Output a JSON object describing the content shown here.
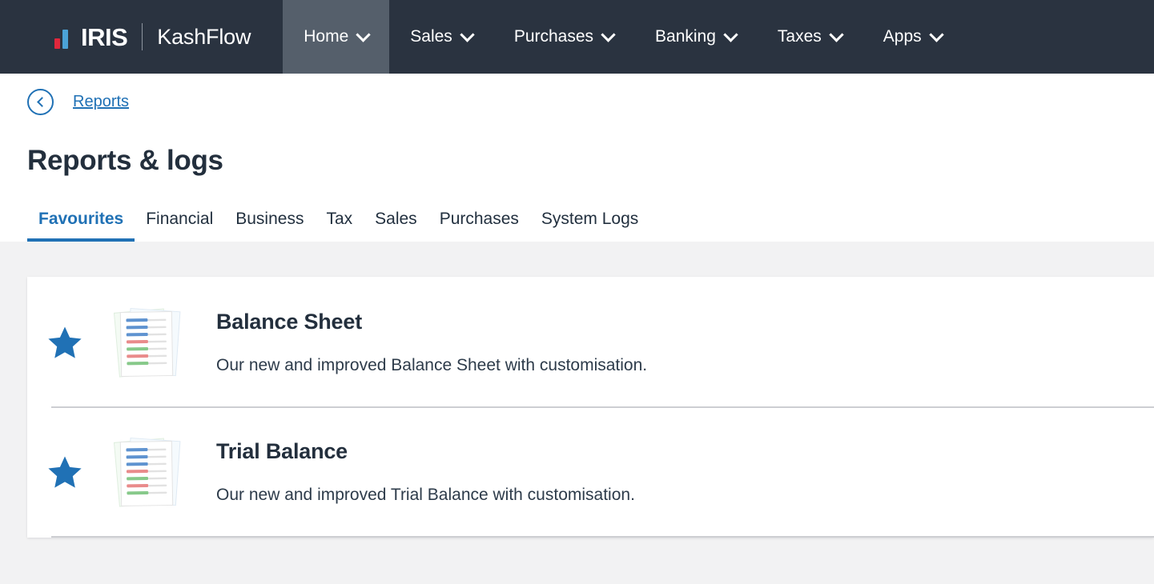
{
  "topbar": {
    "brand": {
      "iris": "IRIS",
      "product": "KashFlow",
      "logo_icon": "iris-bars-logo",
      "accent_red": "#e0273c",
      "accent_blue": "#4ba3d8",
      "bar_background": "#2a3340",
      "active_background": "#555f6b"
    },
    "nav": [
      {
        "label": "Home",
        "active": true,
        "caret": "chevron-down-icon"
      },
      {
        "label": "Sales",
        "active": false,
        "caret": "chevron-down-icon"
      },
      {
        "label": "Purchases",
        "active": false,
        "caret": "chevron-down-icon"
      },
      {
        "label": "Banking",
        "active": false,
        "caret": "chevron-down-icon"
      },
      {
        "label": "Taxes",
        "active": false,
        "caret": "chevron-down-icon"
      },
      {
        "label": "Apps",
        "active": false,
        "caret": "chevron-down-icon"
      }
    ]
  },
  "breadcrumb": {
    "back_icon": "back-circle-chevron-icon",
    "link_label": "Reports"
  },
  "page": {
    "title": "Reports & logs",
    "link_color": "#2071b5",
    "heading_color": "#232f3d",
    "background": "#f2f2f3"
  },
  "tabs": [
    {
      "label": "Favourites",
      "active": true
    },
    {
      "label": "Financial",
      "active": false
    },
    {
      "label": "Business",
      "active": false
    },
    {
      "label": "Tax",
      "active": false
    },
    {
      "label": "Sales",
      "active": false
    },
    {
      "label": "Purchases",
      "active": false
    },
    {
      "label": "System Logs",
      "active": false
    }
  ],
  "reports": [
    {
      "favourite_icon": "star-filled-icon",
      "favourite": true,
      "doc_icon": "report-documents-icon",
      "title": "Balance Sheet",
      "description": "Our new and improved Balance Sheet with customisation."
    },
    {
      "favourite_icon": "star-filled-icon",
      "favourite": true,
      "doc_icon": "report-documents-icon",
      "title": "Trial Balance",
      "description": "Our new and improved Trial Balance with customisation."
    }
  ]
}
